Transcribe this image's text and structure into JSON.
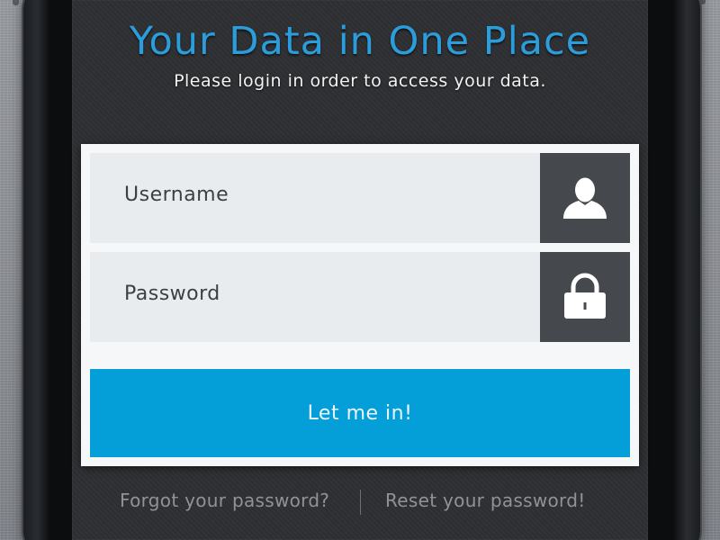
{
  "header": {
    "title": "Your Data in One Place",
    "subtitle": "Please login in order to access your data."
  },
  "form": {
    "username_placeholder": "Username",
    "username_icon": "user-icon",
    "password_placeholder": "Password",
    "password_icon": "lock-icon",
    "submit_label": "Let me in!"
  },
  "links": {
    "forgot": "Forgot your password?",
    "reset": "Reset your password!"
  },
  "colors": {
    "accent": "#049ed8",
    "title": "#2b9ddb",
    "screen_bg": "#2f3033",
    "icon_box": "#45484c",
    "field_bg": "#e8ecef"
  }
}
